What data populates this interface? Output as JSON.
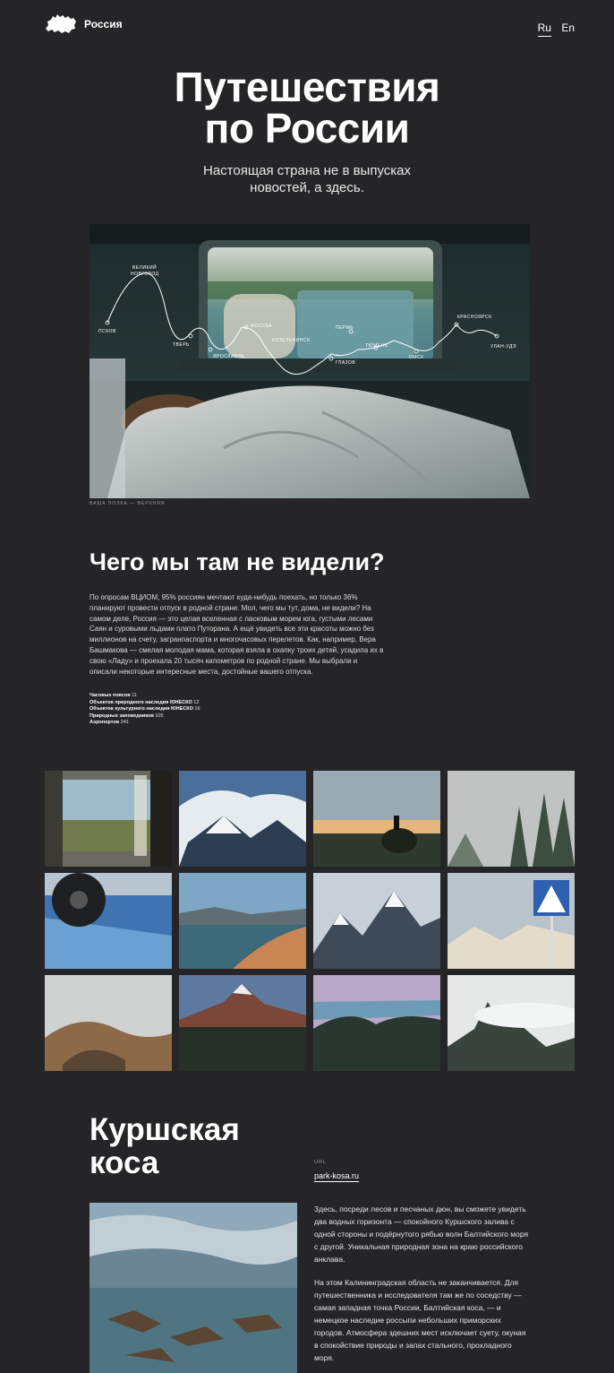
{
  "header": {
    "logo_text": "Россия",
    "lang": [
      "Ru",
      "En"
    ]
  },
  "hero": {
    "title_line1": "Путешествия",
    "title_line2": "по России",
    "subtitle_line1": "Настоящая страна не в выпусках",
    "subtitle_line2": "новостей, а здесь.",
    "route_labels": [
      "ВЕЛИКИЙ",
      "НОВГОРОД",
      "ПСКОВ",
      "ТВЕРЬ",
      "ЯРОСЛАВЛЬ",
      "МОСКВА",
      "КОЗЕЛЬНИНСК",
      "ГЛАЗОВ",
      "ПЕРМЬ",
      "ТЮМЕНЬ",
      "ОМСК",
      "КРАСНОЯРСК",
      "УЛАН-УДЭ"
    ],
    "caption": "ВАША ПОЛКА — ВЕРХНЯЯ"
  },
  "intro": {
    "title": "Чего мы там не видели?",
    "text": "По опросам ВЦИОМ, 95% россиян мечтают куда-нибудь поехать, но только 36% планируют провести отпуск в родной стране. Мол, чего мы тут, дома, не видели? На самом деле, Россия — это целая вселенная с ласковым морем юга, густыми лесами Саян и суровыми льдами плато Путорана. А ещё увидеть все эти красоты можно без миллионов на счету, загранпаспорта и многочасовых перелетов. Как, например, Вера Башмакова — смелая молодая мама, которая взяла в охапку троих детей, усадила их в свою «Ладу» и проехала 20 тысяч километров по родной стране. Мы выбрали и описали некоторые интересные места, достойные вашего отпуска.",
    "stats": [
      {
        "label": "Часовых поясов",
        "value": "11"
      },
      {
        "label": "Объектов природного наследия ЮНЕСКО",
        "value": "12"
      },
      {
        "label": "Объектов культурного наследия ЮНЕСКО",
        "value": "16"
      },
      {
        "label": "Природных заповедников",
        "value": "105"
      },
      {
        "label": "Аэропортов",
        "value": "241"
      }
    ]
  },
  "kosa": {
    "title_line1": "Куршская",
    "title_line2": "коса",
    "url_label": "URL",
    "url": "park-kosa.ru",
    "p1": "Здесь, посреди лесов и песчаных дюн, вы сможете увидеть два водных горизонта — спокойного Куршского залива с одной стороны и подёрнутого рябью волн Балтийского моря с другой. Уникальная природная зона на краю российского анклава.",
    "p2": "На этом Калининградская область не заканчивается. Для путешественника и исследователя там же по соседству — самая западная точка России, Балтийская коса, — и немецкое наследие россыпи небольших приморских городов. Атмосфера здешних мест исключает суету, окуная в спокойствие природы и запах стального, прохладного моря."
  }
}
